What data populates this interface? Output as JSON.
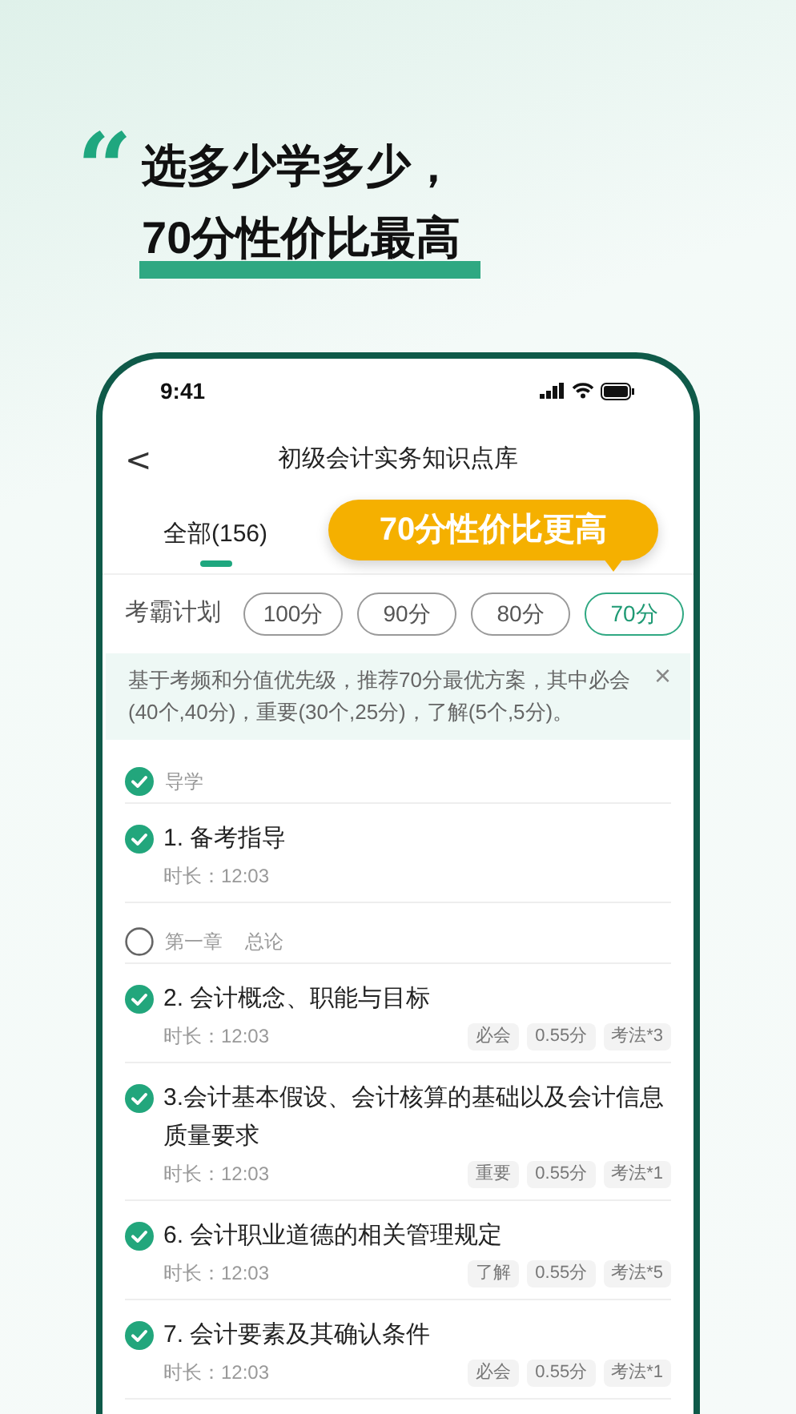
{
  "headline": {
    "quote_mark": "“",
    "lines": [
      "选多少学多少，",
      "70分性价比最高"
    ]
  },
  "status_bar": {
    "time": "9:41"
  },
  "nav": {
    "back": "<",
    "title": "初级会计实务知识点库"
  },
  "tabs": [
    {
      "label": "全部(156)",
      "selected": true
    }
  ],
  "callout": "70分性价比更高",
  "plan": {
    "label": "考霸计划",
    "options": [
      {
        "label": "100分",
        "selected": false
      },
      {
        "label": "90分",
        "selected": false
      },
      {
        "label": "80分",
        "selected": false
      },
      {
        "label": "70分",
        "selected": true
      }
    ]
  },
  "banner": {
    "text": "基于考频和分值优先级，推荐70分最优方案，其中必会(40个,40分)，重要(30个,25分)，了解(5个,5分)。",
    "close": "×"
  },
  "list": [
    {
      "kind": "section",
      "checked": true,
      "texts": [
        "导学"
      ]
    },
    {
      "kind": "lesson",
      "checked": true,
      "title": "1. 备考指导",
      "duration": "时长：12:03"
    },
    {
      "kind": "section",
      "checked": false,
      "texts": [
        "第一章",
        "总论"
      ]
    },
    {
      "kind": "lesson",
      "checked": true,
      "title": "2. 会计概念、职能与目标",
      "duration": "时长：12:03",
      "tags": [
        "必会",
        "0.55分",
        "考法*3"
      ]
    },
    {
      "kind": "lesson",
      "checked": true,
      "title": "3.会计基本假设、会计核算的基础以及会计信息质量要求",
      "duration": "时长：12:03",
      "tags": [
        "重要",
        "0.55分",
        "考法*1"
      ]
    },
    {
      "kind": "lesson",
      "checked": true,
      "title": "6. 会计职业道德的相关管理规定",
      "duration": "时长：12:03",
      "tags": [
        "了解",
        "0.55分",
        "考法*5"
      ]
    },
    {
      "kind": "lesson",
      "checked": true,
      "title": "7. 会计要素及其确认条件",
      "duration": "时长：12:03",
      "tags": [
        "必会",
        "0.55分",
        "考法*1"
      ]
    }
  ]
}
